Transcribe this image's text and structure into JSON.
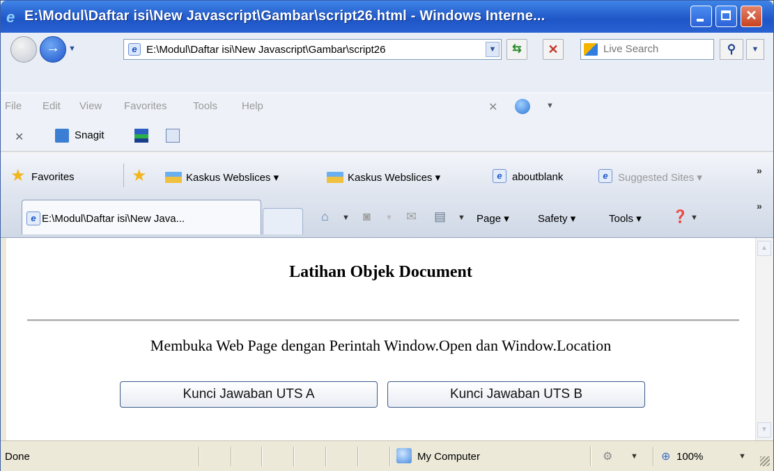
{
  "window": {
    "title": "E:\\Modul\\Daftar isi\\New Javascript\\Gambar\\script26.html - Windows Interne..."
  },
  "address": {
    "url": "E:\\Modul\\Daftar isi\\New Javascript\\Gambar\\script26"
  },
  "search": {
    "placeholder": "Live Search"
  },
  "menu": {
    "items": [
      "File",
      "Edit",
      "View",
      "Favorites",
      "Tools",
      "Help"
    ]
  },
  "snagit": {
    "label": "Snagit"
  },
  "favorites": {
    "label": "Favorites",
    "links": [
      "Kaskus Webslices ▾",
      "Kaskus Webslices ▾",
      "aboutblank",
      "Suggested Sites ▾"
    ]
  },
  "tabs": {
    "active_title": "E:\\Modul\\Daftar isi\\New Java..."
  },
  "command_bar": {
    "page_label": "Page ▾",
    "safety_label": "Safety ▾",
    "tools_label": "Tools ▾"
  },
  "page": {
    "heading": "Latihan Objek Document",
    "text": "Membuka Web Page dengan Perintah Window.Open dan Window.Location",
    "button_a": "Kunci Jawaban UTS A",
    "button_b": "Kunci Jawaban UTS B"
  },
  "status": {
    "text": "Done",
    "zone": "My Computer",
    "zoom": "100%"
  },
  "icons": {
    "browser": "ie-icon",
    "back": "back-arrow-icon",
    "forward": "forward-arrow-icon",
    "refresh": "refresh-icon",
    "stop": "stop-icon",
    "search": "search-icon",
    "favorites": "star-icon",
    "home": "home-icon",
    "feeds": "rss-icon",
    "mail": "mail-icon",
    "print": "printer-icon",
    "help": "help-icon",
    "zone": "computer-icon",
    "zoom": "zoom-icon"
  },
  "colors": {
    "title_bar": "#2e6cd6",
    "close_button": "#c8431e"
  }
}
